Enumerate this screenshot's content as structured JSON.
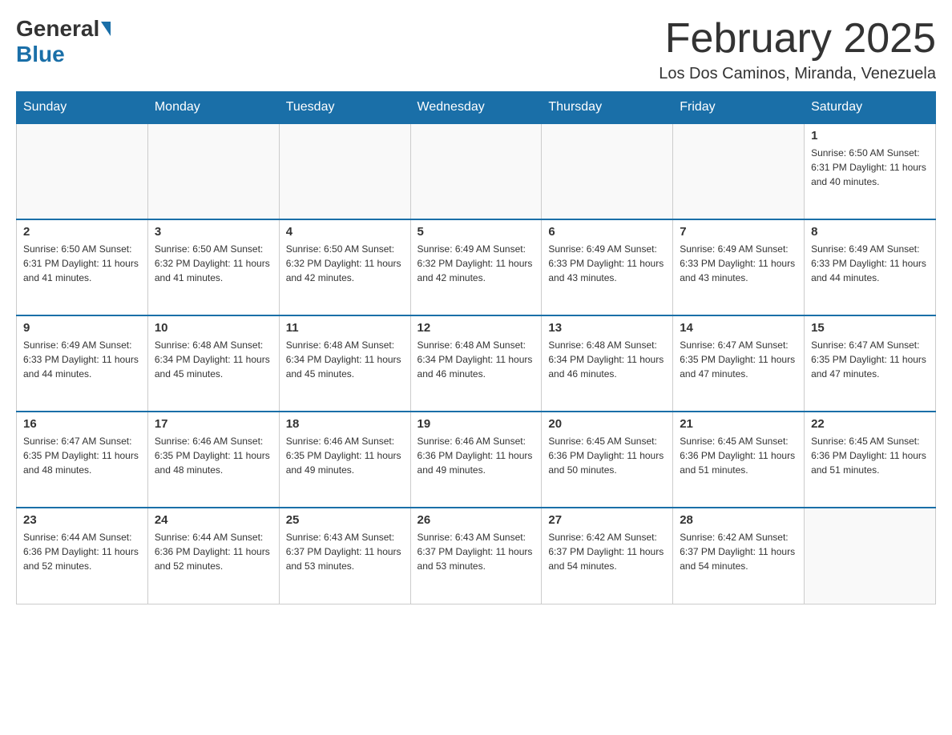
{
  "header": {
    "logo_general": "General",
    "logo_blue": "Blue",
    "month_title": "February 2025",
    "location": "Los Dos Caminos, Miranda, Venezuela"
  },
  "weekdays": [
    "Sunday",
    "Monday",
    "Tuesday",
    "Wednesday",
    "Thursday",
    "Friday",
    "Saturday"
  ],
  "weeks": [
    [
      {
        "day": "",
        "info": ""
      },
      {
        "day": "",
        "info": ""
      },
      {
        "day": "",
        "info": ""
      },
      {
        "day": "",
        "info": ""
      },
      {
        "day": "",
        "info": ""
      },
      {
        "day": "",
        "info": ""
      },
      {
        "day": "1",
        "info": "Sunrise: 6:50 AM\nSunset: 6:31 PM\nDaylight: 11 hours\nand 40 minutes."
      }
    ],
    [
      {
        "day": "2",
        "info": "Sunrise: 6:50 AM\nSunset: 6:31 PM\nDaylight: 11 hours\nand 41 minutes."
      },
      {
        "day": "3",
        "info": "Sunrise: 6:50 AM\nSunset: 6:32 PM\nDaylight: 11 hours\nand 41 minutes."
      },
      {
        "day": "4",
        "info": "Sunrise: 6:50 AM\nSunset: 6:32 PM\nDaylight: 11 hours\nand 42 minutes."
      },
      {
        "day": "5",
        "info": "Sunrise: 6:49 AM\nSunset: 6:32 PM\nDaylight: 11 hours\nand 42 minutes."
      },
      {
        "day": "6",
        "info": "Sunrise: 6:49 AM\nSunset: 6:33 PM\nDaylight: 11 hours\nand 43 minutes."
      },
      {
        "day": "7",
        "info": "Sunrise: 6:49 AM\nSunset: 6:33 PM\nDaylight: 11 hours\nand 43 minutes."
      },
      {
        "day": "8",
        "info": "Sunrise: 6:49 AM\nSunset: 6:33 PM\nDaylight: 11 hours\nand 44 minutes."
      }
    ],
    [
      {
        "day": "9",
        "info": "Sunrise: 6:49 AM\nSunset: 6:33 PM\nDaylight: 11 hours\nand 44 minutes."
      },
      {
        "day": "10",
        "info": "Sunrise: 6:48 AM\nSunset: 6:34 PM\nDaylight: 11 hours\nand 45 minutes."
      },
      {
        "day": "11",
        "info": "Sunrise: 6:48 AM\nSunset: 6:34 PM\nDaylight: 11 hours\nand 45 minutes."
      },
      {
        "day": "12",
        "info": "Sunrise: 6:48 AM\nSunset: 6:34 PM\nDaylight: 11 hours\nand 46 minutes."
      },
      {
        "day": "13",
        "info": "Sunrise: 6:48 AM\nSunset: 6:34 PM\nDaylight: 11 hours\nand 46 minutes."
      },
      {
        "day": "14",
        "info": "Sunrise: 6:47 AM\nSunset: 6:35 PM\nDaylight: 11 hours\nand 47 minutes."
      },
      {
        "day": "15",
        "info": "Sunrise: 6:47 AM\nSunset: 6:35 PM\nDaylight: 11 hours\nand 47 minutes."
      }
    ],
    [
      {
        "day": "16",
        "info": "Sunrise: 6:47 AM\nSunset: 6:35 PM\nDaylight: 11 hours\nand 48 minutes."
      },
      {
        "day": "17",
        "info": "Sunrise: 6:46 AM\nSunset: 6:35 PM\nDaylight: 11 hours\nand 48 minutes."
      },
      {
        "day": "18",
        "info": "Sunrise: 6:46 AM\nSunset: 6:35 PM\nDaylight: 11 hours\nand 49 minutes."
      },
      {
        "day": "19",
        "info": "Sunrise: 6:46 AM\nSunset: 6:36 PM\nDaylight: 11 hours\nand 49 minutes."
      },
      {
        "day": "20",
        "info": "Sunrise: 6:45 AM\nSunset: 6:36 PM\nDaylight: 11 hours\nand 50 minutes."
      },
      {
        "day": "21",
        "info": "Sunrise: 6:45 AM\nSunset: 6:36 PM\nDaylight: 11 hours\nand 51 minutes."
      },
      {
        "day": "22",
        "info": "Sunrise: 6:45 AM\nSunset: 6:36 PM\nDaylight: 11 hours\nand 51 minutes."
      }
    ],
    [
      {
        "day": "23",
        "info": "Sunrise: 6:44 AM\nSunset: 6:36 PM\nDaylight: 11 hours\nand 52 minutes."
      },
      {
        "day": "24",
        "info": "Sunrise: 6:44 AM\nSunset: 6:36 PM\nDaylight: 11 hours\nand 52 minutes."
      },
      {
        "day": "25",
        "info": "Sunrise: 6:43 AM\nSunset: 6:37 PM\nDaylight: 11 hours\nand 53 minutes."
      },
      {
        "day": "26",
        "info": "Sunrise: 6:43 AM\nSunset: 6:37 PM\nDaylight: 11 hours\nand 53 minutes."
      },
      {
        "day": "27",
        "info": "Sunrise: 6:42 AM\nSunset: 6:37 PM\nDaylight: 11 hours\nand 54 minutes."
      },
      {
        "day": "28",
        "info": "Sunrise: 6:42 AM\nSunset: 6:37 PM\nDaylight: 11 hours\nand 54 minutes."
      },
      {
        "day": "",
        "info": ""
      }
    ]
  ]
}
